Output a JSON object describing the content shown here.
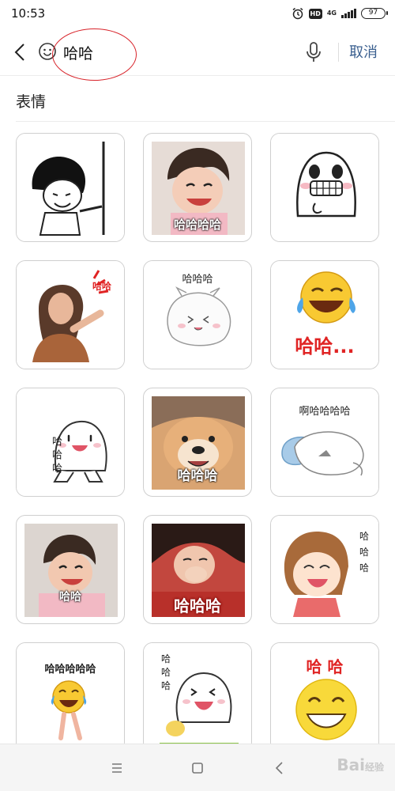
{
  "status": {
    "time": "10:53",
    "hd": "HD",
    "network": "4G",
    "battery": "97"
  },
  "search": {
    "value": "哈哈",
    "cancel_label": "取消"
  },
  "section": {
    "title": "表情"
  },
  "stickers": [
    {
      "caption": ""
    },
    {
      "caption": "哈哈哈哈"
    },
    {
      "caption": ""
    },
    {
      "caption": "哈哈"
    },
    {
      "caption": "哈哈哈"
    },
    {
      "caption": "哈哈..."
    },
    {
      "caption": "哈 哈 哈"
    },
    {
      "caption": "哈哈哈"
    },
    {
      "caption": "啊哈哈哈哈"
    },
    {
      "caption": "哈哈"
    },
    {
      "caption": "哈哈哈"
    },
    {
      "caption": "哈 哈 哈"
    },
    {
      "caption": "哈哈哈哈哈"
    },
    {
      "caption": "哈 哈 哈"
    },
    {
      "caption": "哈 哈"
    }
  ],
  "watermark": {
    "brand": "Bai",
    "sub": "经验"
  },
  "colors": {
    "accent_blue": "#3a5f8f",
    "annotation_red": "#d8232a",
    "border": "#cfcfcf"
  }
}
